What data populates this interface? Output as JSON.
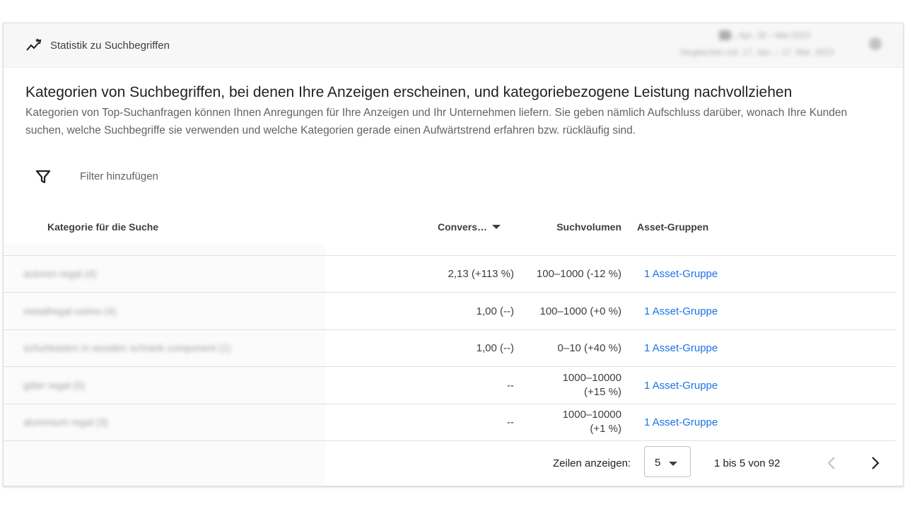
{
  "header": {
    "title": "Statistik zu Suchbegriffen",
    "icon": "trending-up-icon",
    "date_range_line1": "Mi., Apr. 18 – Mai 2023",
    "date_range_line2": "Vergleichen mit: 17. Jan. – 17. Mär. 2023"
  },
  "intro": {
    "title": "Kategorien von Suchbegriffen, bei denen Ihre Anzeigen erscheinen, und kategoriebezogene Leistung nachvollziehen",
    "description": "Kategorien von Top-Suchanfragen können Ihnen Anregungen für Ihre Anzeigen und Ihr Unternehmen liefern. Sie geben nämlich Aufschluss darüber, wonach Ihre Kunden suchen, welche Suchbegriffe sie verwenden und welche Kategorien gerade einen Aufwärtstrend erfahren bzw. rückläufig sind."
  },
  "filter": {
    "label": "Filter hinzufügen",
    "icon": "filter-icon"
  },
  "table": {
    "columns": {
      "category": "Kategorie für die Suche",
      "conversions": "Convers…",
      "volume": "Suchvolumen",
      "asset_groups": "Asset-Gruppen"
    },
    "rows": [
      {
        "category": "autoren regal (4)",
        "conversions": "2,13 (+113 %)",
        "volume": "100–1000 (-12 %)",
        "asset_groups": "1 Asset-Gruppe"
      },
      {
        "category": "metallregal ostmo (4)",
        "conversions": "1,00 (--)",
        "volume": "100–1000 (+0 %)",
        "asset_groups": "1 Asset-Gruppe"
      },
      {
        "category": "schuhkasten in wooden schrank component (1)",
        "conversions": "1,00 (--)",
        "volume": "0–10 (+40 %)",
        "asset_groups": "1 Asset-Gruppe"
      },
      {
        "category": "gitter regal (5)",
        "conversions": "--",
        "volume_line1": "1000–10000",
        "volume_line2": "(+15 %)",
        "asset_groups": "1 Asset-Gruppe"
      },
      {
        "category": "aluminium regal (3)",
        "conversions": "--",
        "volume_line1": "1000–10000",
        "volume_line2": "(+1 %)",
        "asset_groups": "1 Asset-Gruppe"
      }
    ]
  },
  "pagination": {
    "rows_label": "Zeilen anzeigen:",
    "rows_value": "5",
    "range": "1 bis 5 von 92"
  },
  "colors": {
    "link": "#1a73e8",
    "text": "#202124",
    "muted": "#5f6368"
  }
}
